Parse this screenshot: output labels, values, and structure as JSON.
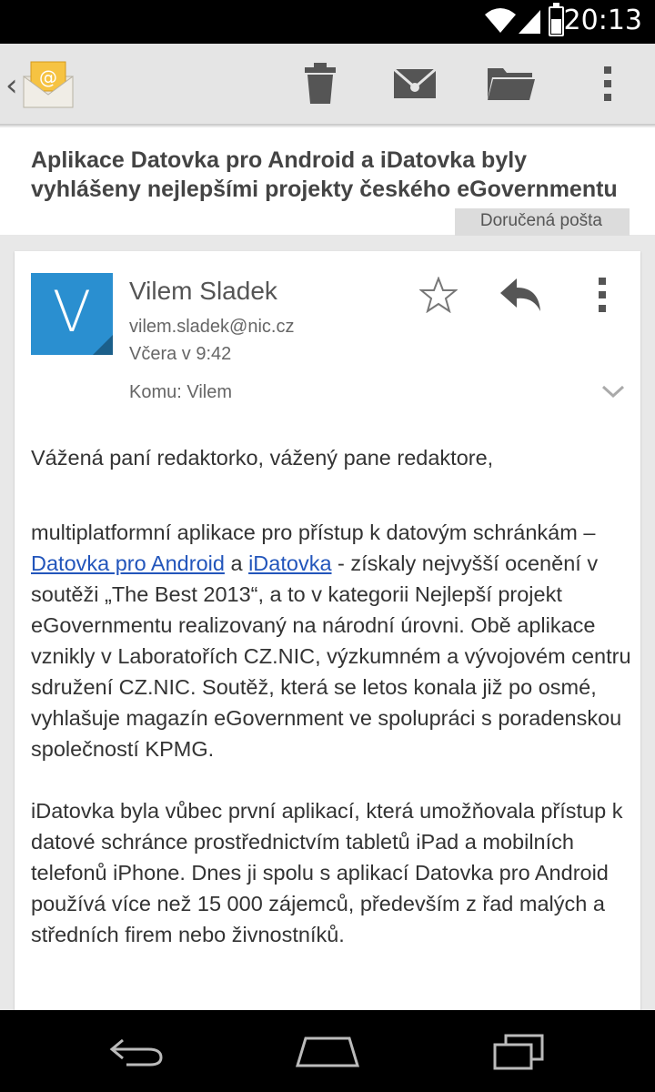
{
  "status_bar": {
    "time": "20:13",
    "battery_level": 0.55
  },
  "action_bar": {
    "icons": [
      "back-chevron-icon",
      "email-app-icon",
      "trash-icon",
      "mark-unread-icon",
      "folder-icon",
      "overflow-icon"
    ]
  },
  "message": {
    "subject": "Aplikace Datovka pro Android a iDatovka byly vyhlášeny nejlepšími projekty českého eGovernmentu",
    "label": "Doručená pošta",
    "sender": {
      "avatar_letter": "V",
      "name": "Vilem Sladek",
      "email": "vilem.sladek@nic.cz",
      "date": "Včera v 9:42"
    },
    "recipient": "Komu: Vilem",
    "body": {
      "greeting": "Vážená paní redaktorko, vážený pane redaktore,",
      "p1_before_link1": "multiplatformní aplikace pro přístup k datovým schránkám – ",
      "link1": "Datovka pro Android",
      "p1_between_links": " a ",
      "link2": "iDatovka",
      "p1_after_links": " - získaly nejvyšší ocenění v soutěži „The Best 2013“, a to v kategorii Nejlepší projekt eGovernmentu realizovaný na národní úrovni. Obě aplikace vznikly v Laboratořích CZ.NIC, výzkumném a vývojovém centru sdružení CZ.NIC. Soutěž, která se letos konala již po osmé, vyhlašuje magazín eGovernment ve spolupráci s poradenskou společností KPMG.",
      "p2": "iDatovka byla vůbec první aplikací, která umožňovala přístup k datové schránce prostřednictvím tabletů iPad a mobilních telefonů iPhone. Dnes ji spolu s aplikací Datovka pro Android používá více než 15 000 zájemců, především z řad malých a středních firem nebo živnostníků."
    }
  },
  "colors": {
    "avatar": "#2a8fd0",
    "link": "#2255bb",
    "actionbar": "#e5e5e5"
  }
}
